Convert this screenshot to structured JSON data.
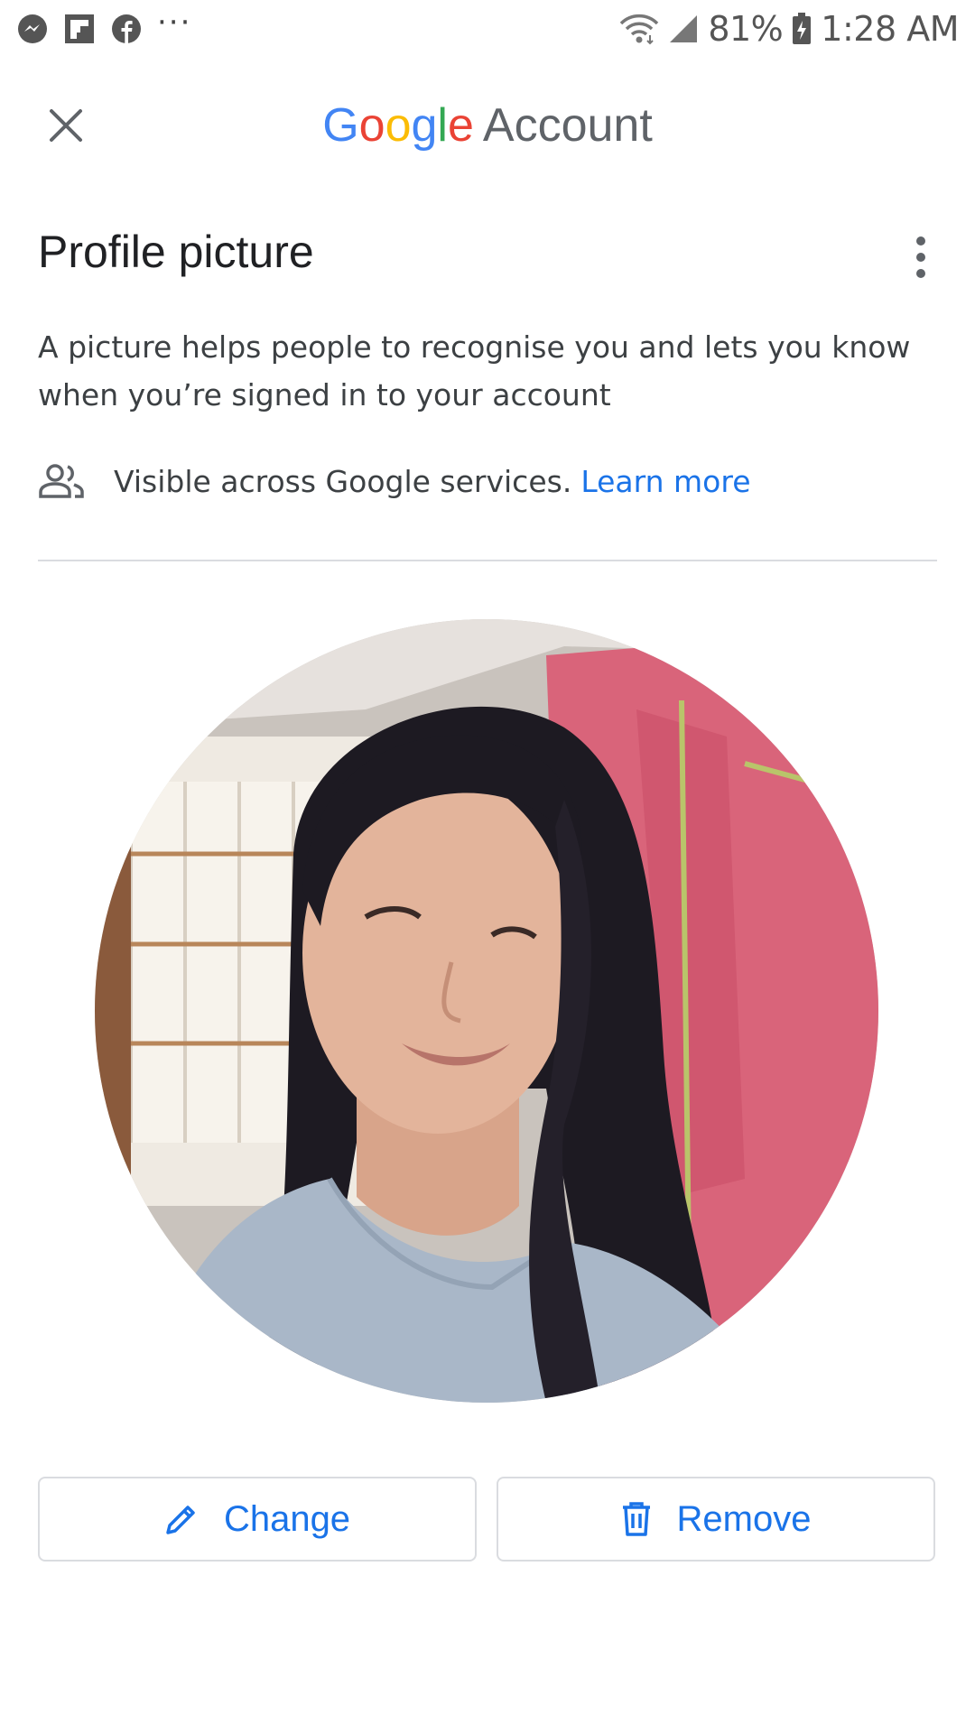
{
  "status_bar": {
    "battery": "81%",
    "time": "1:28 AM",
    "more_indicator": "···",
    "left_icons": [
      "messenger-icon",
      "flipboard-icon",
      "facebook-icon"
    ],
    "right_icons": [
      "wifi-icon",
      "signal-icon",
      "battery-charging-icon"
    ]
  },
  "app_bar": {
    "close_icon": "close-icon",
    "brand_google": [
      "G",
      "o",
      "o",
      "g",
      "l",
      "e"
    ],
    "brand_colors": [
      "#4285F4",
      "#EA4335",
      "#FBBC05",
      "#4285F4",
      "#34A853",
      "#EA4335"
    ],
    "brand_account": "Account"
  },
  "section": {
    "title": "Profile picture",
    "overflow_icon": "more-vert-icon",
    "description": "A picture helps people to recognise you and lets you know when you’re signed in to your account",
    "visibility_icon": "people-icon",
    "visibility_text": "Visible across Google services.",
    "learn_more": "Learn more"
  },
  "profile": {
    "image": "profile-photo"
  },
  "actions": {
    "change_label": "Change",
    "change_icon": "pencil-icon",
    "remove_label": "Remove",
    "remove_icon": "trash-icon"
  },
  "colors": {
    "accent": "#1a73e8",
    "divider": "#dadce0",
    "text_primary": "#202124",
    "text_secondary": "#3c4043"
  }
}
